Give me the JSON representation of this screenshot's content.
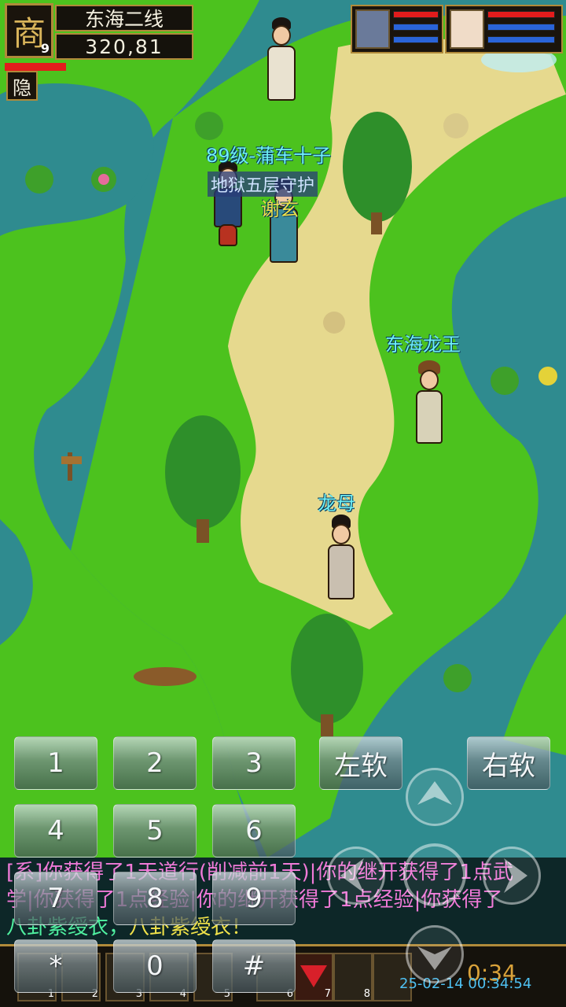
{
  "hud": {
    "avatar_glyph": "商",
    "level": "9",
    "map_name": "东海二线",
    "coords": "320,81",
    "hide_label": "隐"
  },
  "npcs": {
    "npc1_title": "89级-蒲车十子",
    "npc1_subtitle": "地狱五层守护",
    "npc1_name_cut": "谢玄",
    "npc2_name": "东海龙王",
    "player_name": "龙母"
  },
  "keypad": {
    "k1": "1",
    "k2": "2",
    "k3": "3",
    "k4": "4",
    "k5": "5",
    "k6": "6",
    "k7": "7",
    "k8": "8",
    "k9": "9",
    "kstar": "*",
    "k0": "0",
    "khash": "#",
    "left_soft": "左软",
    "right_soft": "右软"
  },
  "chat": {
    "line1": "[系]你获得了1天道行(削减前1天)|你的继开获得了1点武",
    "line2": "学|你获得了1点经验|你的继开获得了1点经验|你获得了",
    "line3_a": "八卦紫绶衣，",
    "line3_b": "八卦紫绶衣！"
  },
  "skillbar": {
    "slot_numbers": [
      "1",
      "2",
      "3",
      "4",
      "5",
      "6",
      "7",
      "8"
    ],
    "clock": "0:34",
    "datetime": "25-02-14 00:34:54"
  },
  "colors": {
    "water": "#2f8b8f",
    "grass": "#4cc21e",
    "sand": "#e6d98e",
    "gold_border": "#b08a3a",
    "hp": "#e21c1c",
    "mp": "#2a64d8"
  }
}
